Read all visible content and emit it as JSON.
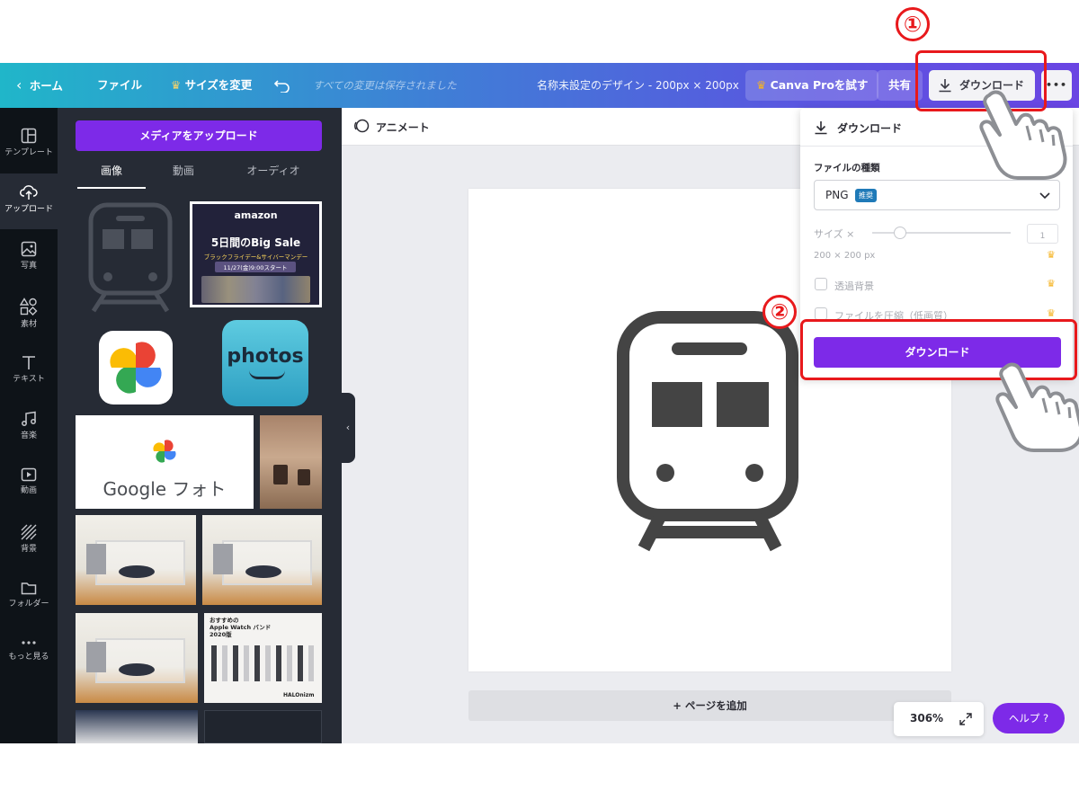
{
  "topbar": {
    "home": "ホーム",
    "file": "ファイル",
    "resize": "サイズを変更",
    "saved_status": "すべての変更は保存されました",
    "design_title": "名称未設定のデザイン - 200px × 200px",
    "try_pro": "Canva Proを試す",
    "share": "共有",
    "download": "ダウンロード",
    "more": "•••"
  },
  "rail": {
    "items": [
      {
        "label": "テンプレート",
        "icon": "template-icon"
      },
      {
        "label": "アップロード",
        "icon": "upload-icon",
        "active": true
      },
      {
        "label": "写真",
        "icon": "photo-icon"
      },
      {
        "label": "素材",
        "icon": "elements-icon"
      },
      {
        "label": "テキスト",
        "icon": "text-icon"
      },
      {
        "label": "音楽",
        "icon": "music-icon"
      },
      {
        "label": "動画",
        "icon": "video-icon"
      },
      {
        "label": "背景",
        "icon": "background-icon"
      },
      {
        "label": "フォルダー",
        "icon": "folder-icon"
      },
      {
        "label": "もっと見る",
        "icon": "more-icon"
      }
    ]
  },
  "panel": {
    "upload_button": "メディアをアップロード",
    "tabs": [
      "画像",
      "動画",
      "オーディオ"
    ],
    "amazon": {
      "brand": "amazon",
      "headline": "5日間のBig Sale",
      "sub": "ブラックフライデー&サイバーマンデー",
      "date": "11/27(金)9:00スタート"
    },
    "photos_logo": "photos",
    "google_photos_text": "Google フォト",
    "watch_text": "おすすめの\nApple Watch バンド\n2020版",
    "watch_brand": "HALOnizm"
  },
  "canvas": {
    "animate": "アニメート",
    "add_page": "+ ページを追加",
    "zoom": "306%",
    "help": "ヘルプ ?"
  },
  "download_panel": {
    "title": "ダウンロード",
    "file_type_label": "ファイルの種類",
    "file_type_value": "PNG",
    "recommended_badge": "推奨",
    "size_label": "サイズ ×",
    "size_value": "1",
    "size_px": "200 × 200 px",
    "transparent_bg": "透過背景",
    "compress": "ファイルを圧縮（低画質）",
    "download_button": "ダウンロード"
  },
  "annotations": {
    "step1": "①",
    "step2": "②"
  },
  "colors": {
    "accent": "#7d2ae8",
    "annotation": "#e8191c",
    "crown": "#f5b323"
  }
}
